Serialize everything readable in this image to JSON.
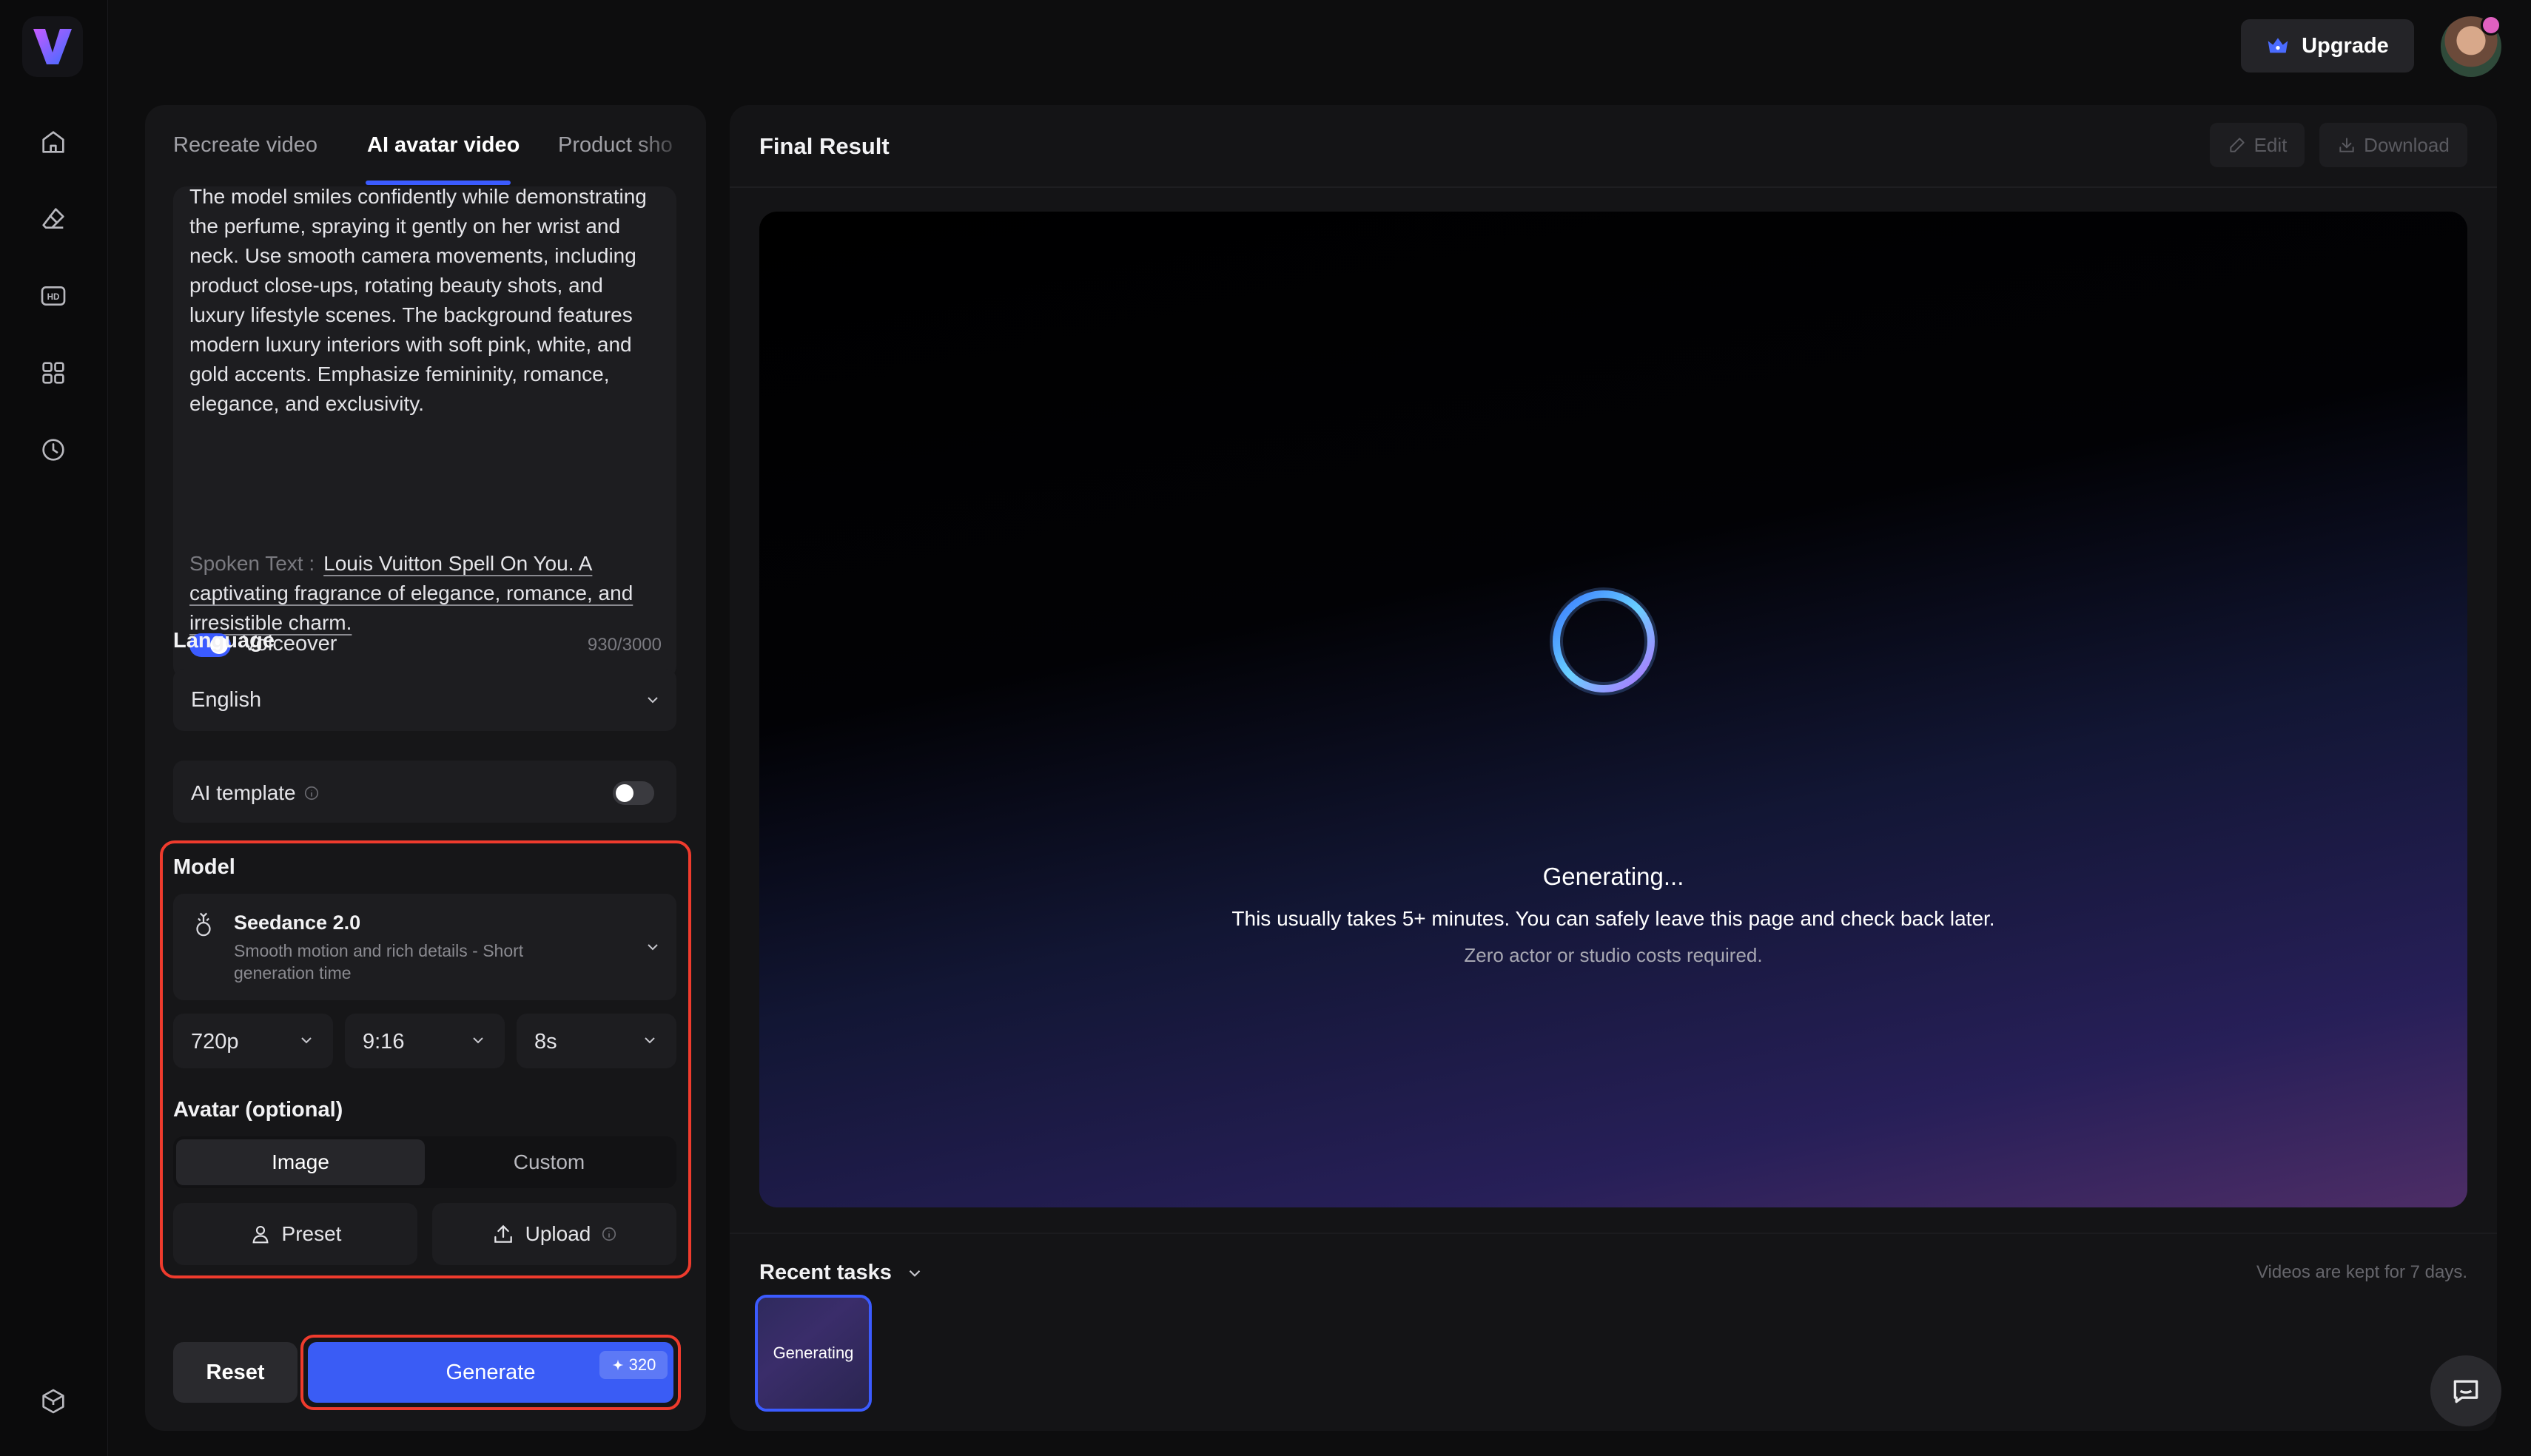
{
  "header": {
    "upgrade_label": "Upgrade"
  },
  "tabs": [
    {
      "label": "Recreate video"
    },
    {
      "label": "AI avatar video"
    },
    {
      "label": "Product sho"
    }
  ],
  "prompt": {
    "text": "The model smiles confidently while demonstrating the perfume, spraying it gently on her wrist and neck. Use smooth camera movements, including product close-ups, rotating beauty shots, and luxury lifestyle scenes. The background features modern luxury interiors with soft pink, white, and gold accents. Emphasize femininity, romance, elegance, and exclusivity.",
    "spoken_label": "Spoken Text :",
    "spoken_value": "Louis Vuitton Spell On You. A captivating fragrance of elegance, romance, and irresistible charm.",
    "voiceover_label": "Voiceover",
    "voiceover_on": true,
    "char_count": "930/3000"
  },
  "language": {
    "label": "Language",
    "value": "English"
  },
  "ai_template": {
    "label": "AI template",
    "enabled": false
  },
  "model": {
    "label": "Model",
    "name": "Seedance 2.0",
    "description": "Smooth motion and rich details - Short generation time",
    "resolution": "720p",
    "aspect_ratio": "9:16",
    "duration": "8s"
  },
  "avatar": {
    "label": "Avatar (optional)",
    "seg_image": "Image",
    "seg_custom": "Custom",
    "preset_label": "Preset",
    "upload_label": "Upload"
  },
  "actions": {
    "reset_label": "Reset",
    "generate_label": "Generate",
    "credits": "320"
  },
  "result": {
    "title": "Final Result",
    "edit_label": "Edit",
    "download_label": "Download",
    "generating_title": "Generating...",
    "generating_sub": "This usually takes 5+ minutes. You can safely leave this page and check back later.",
    "generating_note": "Zero actor or studio costs required."
  },
  "recent": {
    "title": "Recent tasks",
    "kept_note": "Videos are kept for 7 days.",
    "tasks": [
      {
        "status": "Generating"
      }
    ]
  },
  "colors": {
    "accent": "#3b5bff",
    "highlight": "#ef3b2d",
    "panel": "#161618"
  }
}
